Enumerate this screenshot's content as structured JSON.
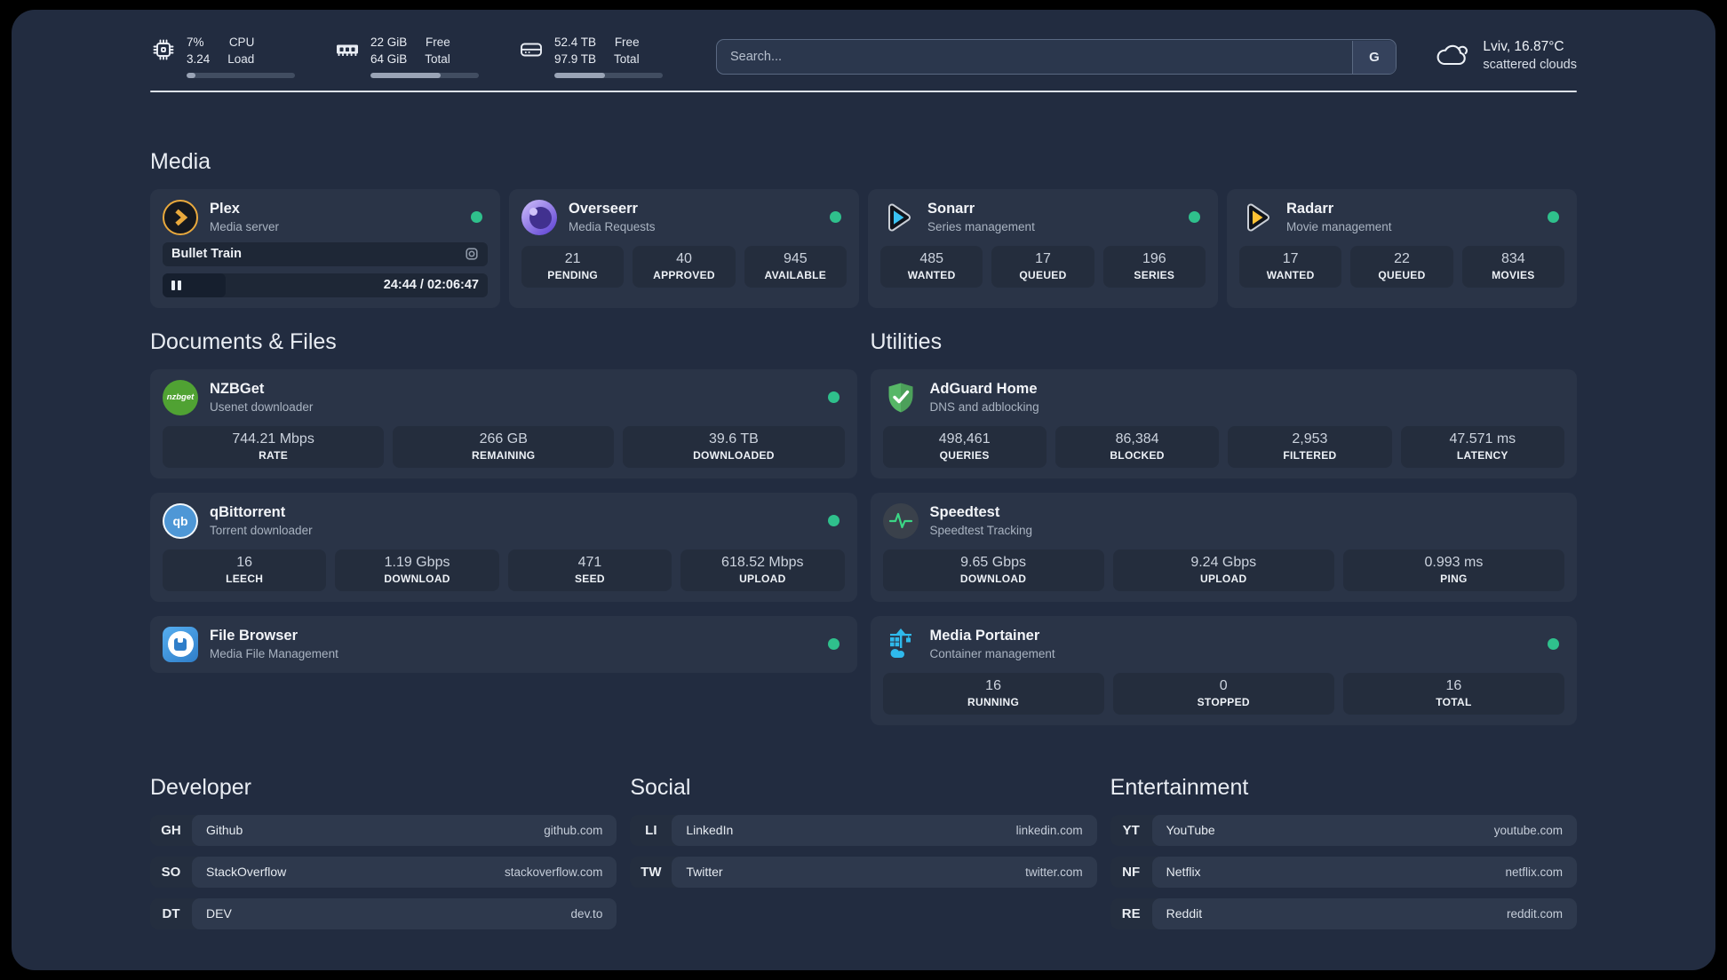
{
  "colors": {
    "status_online": "#2fc08c",
    "plex": "#e9a93d",
    "sonarr": "#3ac2f2",
    "radarr": "#ffc234",
    "nzbget": "#50a233",
    "qbittorrent": "#4e97d6",
    "adguard": "#57b767",
    "speedtest_pulse": "#3bd685",
    "portainer": "#2fb9ec"
  },
  "topbar": {
    "stats": [
      {
        "icon": "cpu-icon",
        "values": [
          "7%",
          "3.24"
        ],
        "labels": [
          "CPU",
          "Load"
        ],
        "progress": 8
      },
      {
        "icon": "memory-icon",
        "values": [
          "22 GiB",
          "64 GiB"
        ],
        "labels": [
          "Free",
          "Total"
        ],
        "progress": 65
      },
      {
        "icon": "disk-icon",
        "values": [
          "52.4 TB",
          "97.9 TB"
        ],
        "labels": [
          "Free",
          "Total"
        ],
        "progress": 47
      }
    ],
    "search": {
      "placeholder": "Search...",
      "engine_label": "G"
    },
    "weather": {
      "icon": "cloud-icon",
      "location_temp": "Lviv, 16.87°C",
      "condition": "scattered clouds"
    }
  },
  "media": {
    "title": "Media",
    "cards": {
      "plex": {
        "icon": "plex-icon",
        "title": "Plex",
        "subtitle": "Media server",
        "online": true,
        "nowplaying": {
          "item_title": "Bullet Train",
          "time": "24:44 / 02:06:47",
          "progress": 19.5
        }
      },
      "overseerr": {
        "icon": "overseerr-icon",
        "title": "Overseerr",
        "subtitle": "Media Requests",
        "online": true,
        "stats": [
          {
            "value": "21",
            "label": "PENDING"
          },
          {
            "value": "40",
            "label": "APPROVED"
          },
          {
            "value": "945",
            "label": "AVAILABLE"
          }
        ]
      },
      "sonarr": {
        "icon": "sonarr-icon",
        "title": "Sonarr",
        "subtitle": "Series management",
        "online": true,
        "stats": [
          {
            "value": "485",
            "label": "WANTED"
          },
          {
            "value": "17",
            "label": "QUEUED"
          },
          {
            "value": "196",
            "label": "SERIES"
          }
        ]
      },
      "radarr": {
        "icon": "radarr-icon",
        "title": "Radarr",
        "subtitle": "Movie management",
        "online": true,
        "stats": [
          {
            "value": "17",
            "label": "WANTED"
          },
          {
            "value": "22",
            "label": "QUEUED"
          },
          {
            "value": "834",
            "label": "MOVIES"
          }
        ]
      }
    }
  },
  "documents": {
    "title": "Documents & Files",
    "cards": {
      "nzbget": {
        "icon": "nzbget-icon",
        "icon_text": "nzbget",
        "title": "NZBGet",
        "subtitle": "Usenet downloader",
        "online": true,
        "stats": [
          {
            "value": "744.21 Mbps",
            "label": "RATE"
          },
          {
            "value": "266 GB",
            "label": "REMAINING"
          },
          {
            "value": "39.6 TB",
            "label": "DOWNLOADED"
          }
        ]
      },
      "qbittorrent": {
        "icon": "qbittorrent-icon",
        "icon_text": "qb",
        "title": "qBittorrent",
        "subtitle": "Torrent downloader",
        "online": true,
        "stats": [
          {
            "value": "16",
            "label": "LEECH"
          },
          {
            "value": "1.19 Gbps",
            "label": "DOWNLOAD"
          },
          {
            "value": "471",
            "label": "SEED"
          },
          {
            "value": "618.52 Mbps",
            "label": "UPLOAD"
          }
        ]
      },
      "filebrowser": {
        "icon": "filebrowser-icon",
        "title": "File Browser",
        "subtitle": "Media File Management",
        "online": true
      }
    }
  },
  "utilities": {
    "title": "Utilities",
    "cards": {
      "adguard": {
        "icon": "adguard-icon",
        "title": "AdGuard Home",
        "subtitle": "DNS and adblocking",
        "stats": [
          {
            "value": "498,461",
            "label": "QUERIES"
          },
          {
            "value": "86,384",
            "label": "BLOCKED"
          },
          {
            "value": "2,953",
            "label": "FILTERED"
          },
          {
            "value": "47.571 ms",
            "label": "LATENCY"
          }
        ]
      },
      "speedtest": {
        "icon": "speedtest-icon",
        "title": "Speedtest",
        "subtitle": "Speedtest Tracking",
        "stats": [
          {
            "value": "9.65 Gbps",
            "label": "DOWNLOAD"
          },
          {
            "value": "9.24 Gbps",
            "label": "UPLOAD"
          },
          {
            "value": "0.993 ms",
            "label": "PING"
          }
        ]
      },
      "portainer": {
        "icon": "portainer-icon",
        "title": "Media Portainer",
        "subtitle": "Container management",
        "online": true,
        "stats": [
          {
            "value": "16",
            "label": "RUNNING"
          },
          {
            "value": "0",
            "label": "STOPPED"
          },
          {
            "value": "16",
            "label": "TOTAL"
          }
        ]
      }
    }
  },
  "bookmarks": {
    "developer": {
      "title": "Developer",
      "items": [
        {
          "abbr": "GH",
          "name": "Github",
          "url": "github.com"
        },
        {
          "abbr": "SO",
          "name": "StackOverflow",
          "url": "stackoverflow.com"
        },
        {
          "abbr": "DT",
          "name": "DEV",
          "url": "dev.to"
        }
      ]
    },
    "social": {
      "title": "Social",
      "items": [
        {
          "abbr": "LI",
          "name": "LinkedIn",
          "url": "linkedin.com"
        },
        {
          "abbr": "TW",
          "name": "Twitter",
          "url": "twitter.com"
        }
      ]
    },
    "entertainment": {
      "title": "Entertainment",
      "items": [
        {
          "abbr": "YT",
          "name": "YouTube",
          "url": "youtube.com"
        },
        {
          "abbr": "NF",
          "name": "Netflix",
          "url": "netflix.com"
        },
        {
          "abbr": "RE",
          "name": "Reddit",
          "url": "reddit.com"
        }
      ]
    }
  }
}
